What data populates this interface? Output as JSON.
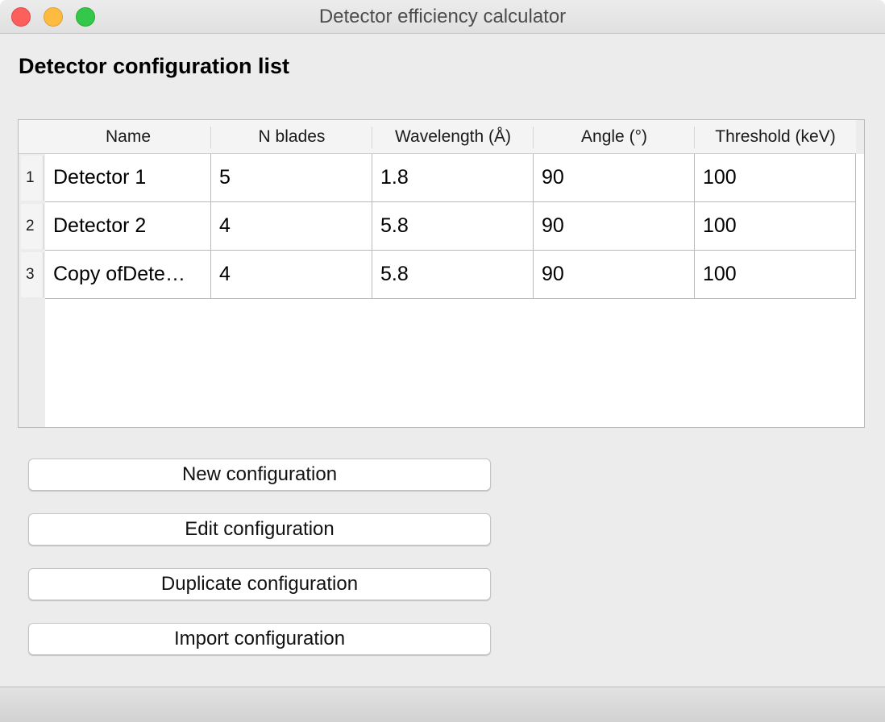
{
  "window": {
    "title": "Detector efficiency calculator"
  },
  "heading": "Detector configuration list",
  "table": {
    "columns": [
      "Name",
      "N blades",
      "Wavelength (Å)",
      "Angle (°)",
      "Threshold (keV)"
    ],
    "rows": [
      {
        "index": "1",
        "cells": [
          "Detector 1",
          "5",
          "1.8",
          "90",
          "100"
        ]
      },
      {
        "index": "2",
        "cells": [
          "Detector 2",
          "4",
          "5.8",
          "90",
          "100"
        ]
      },
      {
        "index": "3",
        "cells": [
          "Copy ofDete…",
          "4",
          "5.8",
          "90",
          "100"
        ]
      }
    ]
  },
  "buttons": {
    "new": "New configuration",
    "edit": "Edit configuration",
    "duplicate": "Duplicate configuration",
    "import": "Import configuration"
  },
  "colors": {
    "close": "#fc605c",
    "minimize": "#fdbc40",
    "zoom": "#34c84a"
  }
}
